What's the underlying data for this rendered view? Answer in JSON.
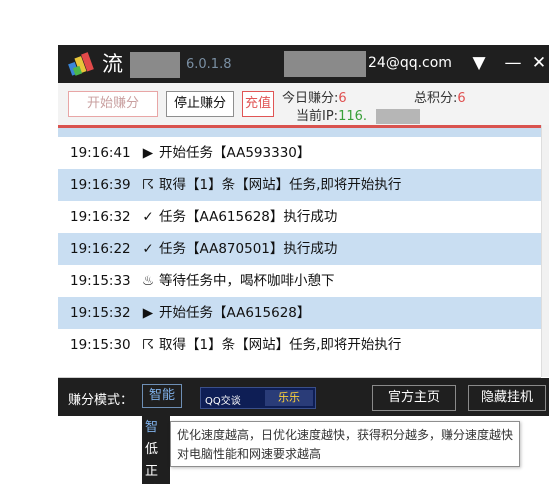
{
  "app": {
    "name": "流",
    "version": "6.0.1.8",
    "email": "24@qq.com"
  },
  "titlebar": {
    "menu_glyph": "▼",
    "minimize_glyph": "—",
    "close_glyph": "✕"
  },
  "toolbar": {
    "start_label": "开始赚分",
    "stop_label": "停止赚分",
    "recharge_label": "充值",
    "today_label": "今日赚分:",
    "today_value": "6",
    "total_label": "总积分:",
    "total_value": "6",
    "ip_label": "当前IP:",
    "ip_value": "116."
  },
  "log": {
    "rows": [
      {
        "time": "19:16:41",
        "icon": "▶",
        "msg": "开始任务【AA593330】"
      },
      {
        "time": "19:16:39",
        "icon": "☈",
        "msg": "取得【1】条【网站】任务,即将开始执行"
      },
      {
        "time": "19:16:32",
        "icon": "✓",
        "msg": "任务【AA615628】执行成功"
      },
      {
        "time": "19:16:22",
        "icon": "✓",
        "msg": "任务【AA870501】执行成功"
      },
      {
        "time": "19:15:33",
        "icon": "♨",
        "msg": "等待任务中，喝杯咖啡小憩下"
      },
      {
        "time": "19:15:32",
        "icon": "▶",
        "msg": "开始任务【AA615628】"
      },
      {
        "time": "19:15:30",
        "icon": "☈",
        "msg": "取得【1】条【网站】任务,即将开始执行"
      }
    ]
  },
  "bottom": {
    "mode_label": "赚分模式：",
    "mode_value": "智能",
    "qq_label": "QQ交谈",
    "qq_name": "乐乐",
    "home_label": "官方主页",
    "hide_label": "隐藏挂机"
  },
  "mode_options": [
    "智",
    "低",
    "正常"
  ],
  "tooltip": "优化速度越高，日优化速度越快，获得积分越多，赚分速度越快对电脑性能和网速要求越高",
  "colors": {
    "titlebar": "#1f1f1f",
    "row_highlight": "#c9def2",
    "accent_red": "#e05050",
    "accent_blue": "#7fb0e8"
  }
}
